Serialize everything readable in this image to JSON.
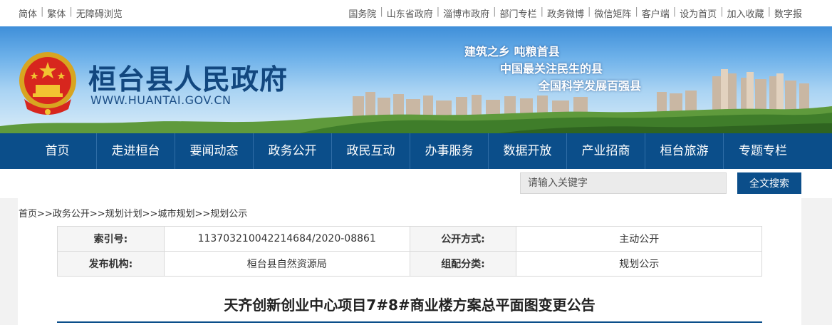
{
  "topbar": {
    "left_links": [
      "简体",
      "繁体",
      "无障碍浏览"
    ],
    "right_links": [
      "国务院",
      "山东省政府",
      "淄博市政府",
      "部门专栏",
      "政务微博",
      "微信矩阵",
      "客户端",
      "设为首页",
      "加入收藏",
      "数字报"
    ]
  },
  "header": {
    "site_name": "桓台县人民政府",
    "site_url": "WWW.HUANTAI.GOV.CN",
    "slogans": [
      "建筑之乡 吨粮首县",
      "中国最关注民生的县",
      "全国科学发展百强县"
    ]
  },
  "nav": {
    "items": [
      "首页",
      "走进桓台",
      "要闻动态",
      "政务公开",
      "政民互动",
      "办事服务",
      "数据开放",
      "产业招商",
      "桓台旅游",
      "专题专栏"
    ]
  },
  "search": {
    "placeholder": "请输入关键字",
    "button_label": "全文搜索"
  },
  "breadcrumb": {
    "items": [
      "首页",
      "政务公开",
      "规划计划",
      "城市规划",
      "规划公示"
    ],
    "separator": ">>"
  },
  "meta": {
    "index_label": "索引号:",
    "index_value": "11370321004221468​4/2020-08861",
    "disclosure_label": "公开方式:",
    "disclosure_value": "主动公开",
    "publisher_label": "发布机构:",
    "publisher_value": "桓台县自然资源局",
    "category_label": "组配分类:",
    "category_value": "规划公示"
  },
  "document": {
    "title": "天齐创新创业中心项目7#8#商业楼方案总平面图变更公告"
  },
  "colors": {
    "nav_bg": "#0b4e8a",
    "title_blue": "#12477f"
  }
}
